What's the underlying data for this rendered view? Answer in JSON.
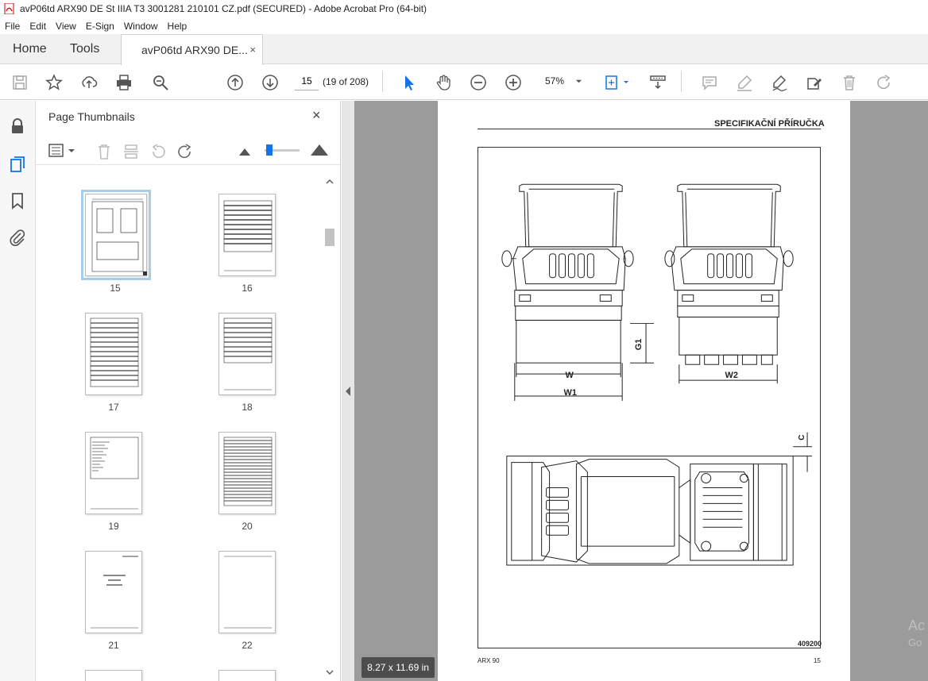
{
  "window": {
    "title": "avP06td ARX90 DE St IIIA T3 3001281 210101 CZ.pdf (SECURED) - Adobe Acrobat Pro (64-bit)"
  },
  "menu": [
    "File",
    "Edit",
    "View",
    "E-Sign",
    "Window",
    "Help"
  ],
  "tabs": {
    "home": "Home",
    "tools": "Tools",
    "document": "avP06td ARX90 DE...",
    "close_glyph": "×"
  },
  "toolbar": {
    "page_number": "15",
    "page_count": "(19 of 208)",
    "zoom": "57%",
    "icons": [
      "save-icon",
      "bookmark-star-icon",
      "upload-icon",
      "print-icon",
      "find-icon",
      "prev-page-icon",
      "next-page-icon",
      "select-cursor-icon",
      "hand-icon",
      "zoom-out-icon",
      "zoom-in-icon",
      "fit-page-icon",
      "scroll-mode-icon",
      "comment-icon",
      "highlight-icon",
      "sign-icon",
      "edit-pdf-icon",
      "delete-icon",
      "redo-icon"
    ]
  },
  "left_rail": {
    "icons": [
      "lock-icon",
      "pages-icon",
      "bookmark-icon",
      "attachment-icon"
    ]
  },
  "thumbnails_panel": {
    "title": "Page Thumbnails",
    "close_glyph": "×",
    "thumbnails": [
      {
        "label": "15",
        "selected": true
      },
      {
        "label": "16",
        "selected": false
      },
      {
        "label": "17",
        "selected": false
      },
      {
        "label": "18",
        "selected": false
      },
      {
        "label": "19",
        "selected": false
      },
      {
        "label": "20",
        "selected": false
      },
      {
        "label": "21",
        "selected": false
      },
      {
        "label": "22",
        "selected": false
      }
    ]
  },
  "document": {
    "heading": "SPECIFIKAČNÍ PŘÍRUČKA",
    "figure_number": "409200",
    "footer_left": "ARX 90",
    "footer_right": "15",
    "dimension_labels": {
      "w": "W",
      "w1": "W1",
      "w2": "W2",
      "g1": "G1",
      "c": "C"
    },
    "page_size": "8.27 x 11.69 in"
  },
  "watermark": {
    "line1": "Ac",
    "line2": "Go"
  },
  "colors": {
    "accent": "#1473e6",
    "selection": "#a6cde9",
    "toolbar_icon": "#555555"
  }
}
